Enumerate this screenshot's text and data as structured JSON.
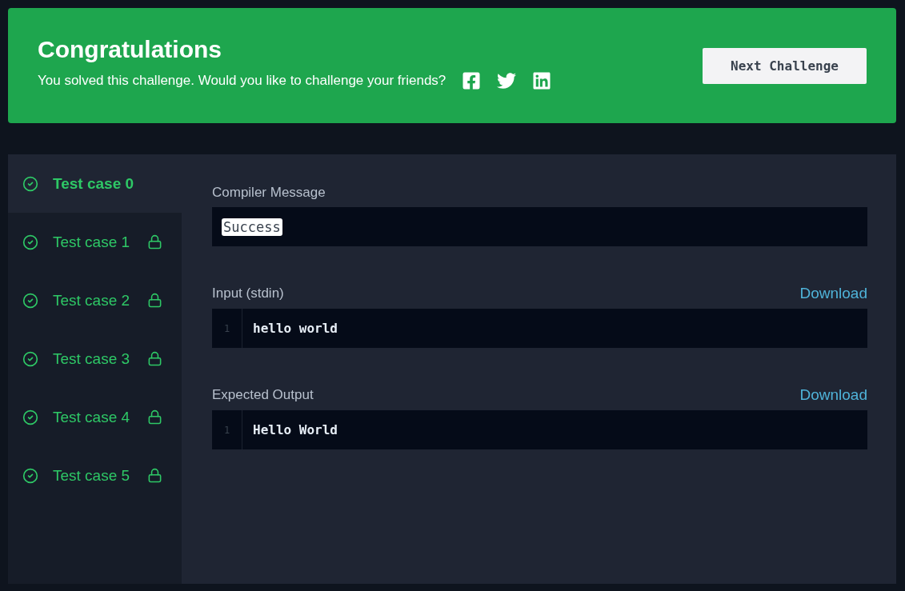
{
  "banner": {
    "title": "Congratulations",
    "message": "You solved this challenge. Would you like to challenge your friends?",
    "button": "Next Challenge"
  },
  "test_cases": [
    {
      "label": "Test case 0",
      "selected": true,
      "passed": true,
      "locked": false
    },
    {
      "label": "Test case 1",
      "selected": false,
      "passed": true,
      "locked": true
    },
    {
      "label": "Test case 2",
      "selected": false,
      "passed": true,
      "locked": true
    },
    {
      "label": "Test case 3",
      "selected": false,
      "passed": true,
      "locked": true
    },
    {
      "label": "Test case 4",
      "selected": false,
      "passed": true,
      "locked": true
    },
    {
      "label": "Test case 5",
      "selected": false,
      "passed": true,
      "locked": true
    }
  ],
  "sections": [
    {
      "kind": "message",
      "title": "Compiler Message",
      "text": "Success"
    },
    {
      "kind": "code",
      "title": "Input (stdin)",
      "link": "Download",
      "lines": [
        {
          "number": "1",
          "text": "hello world"
        }
      ]
    },
    {
      "kind": "code",
      "title": "Expected Output",
      "link": "Download",
      "lines": [
        {
          "number": "1",
          "text": "Hello World"
        }
      ]
    }
  ]
}
